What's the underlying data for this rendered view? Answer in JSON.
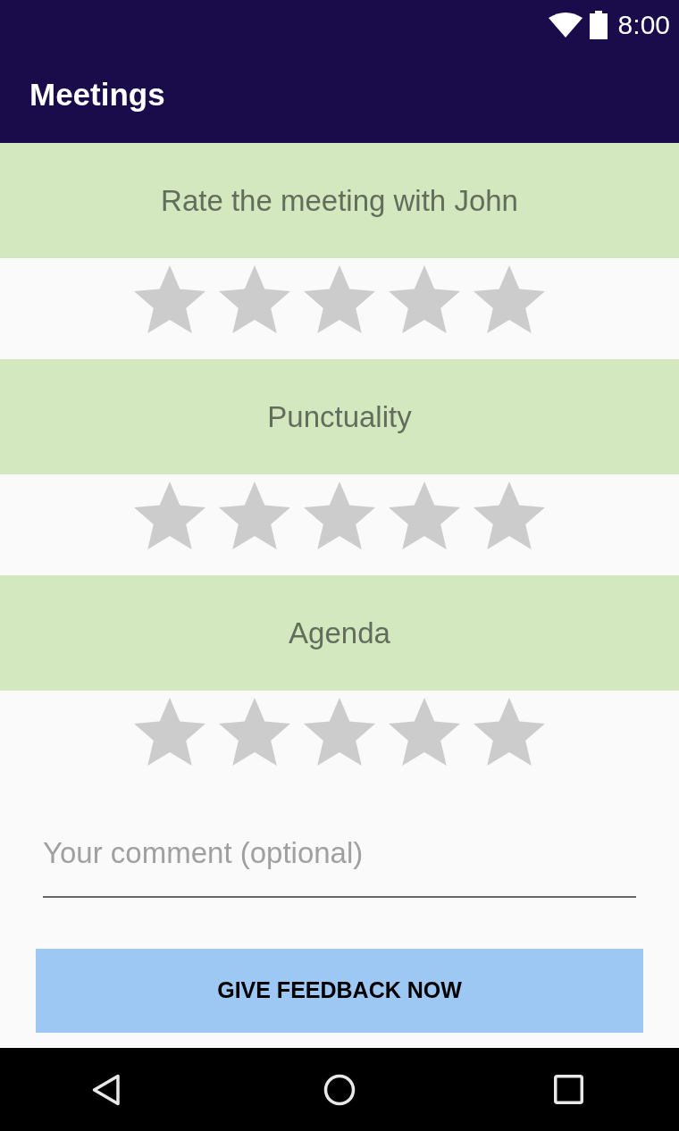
{
  "status_bar": {
    "time": "8:00"
  },
  "app_bar": {
    "title": "Meetings"
  },
  "ratings": [
    {
      "title": "Rate the meeting with John",
      "stars": 0
    },
    {
      "title": "Punctuality",
      "stars": 0
    },
    {
      "title": "Agenda",
      "stars": 0
    }
  ],
  "comment": {
    "placeholder": "Your comment (optional)"
  },
  "submit_button": {
    "label": "GIVE FEEDBACK NOW"
  }
}
